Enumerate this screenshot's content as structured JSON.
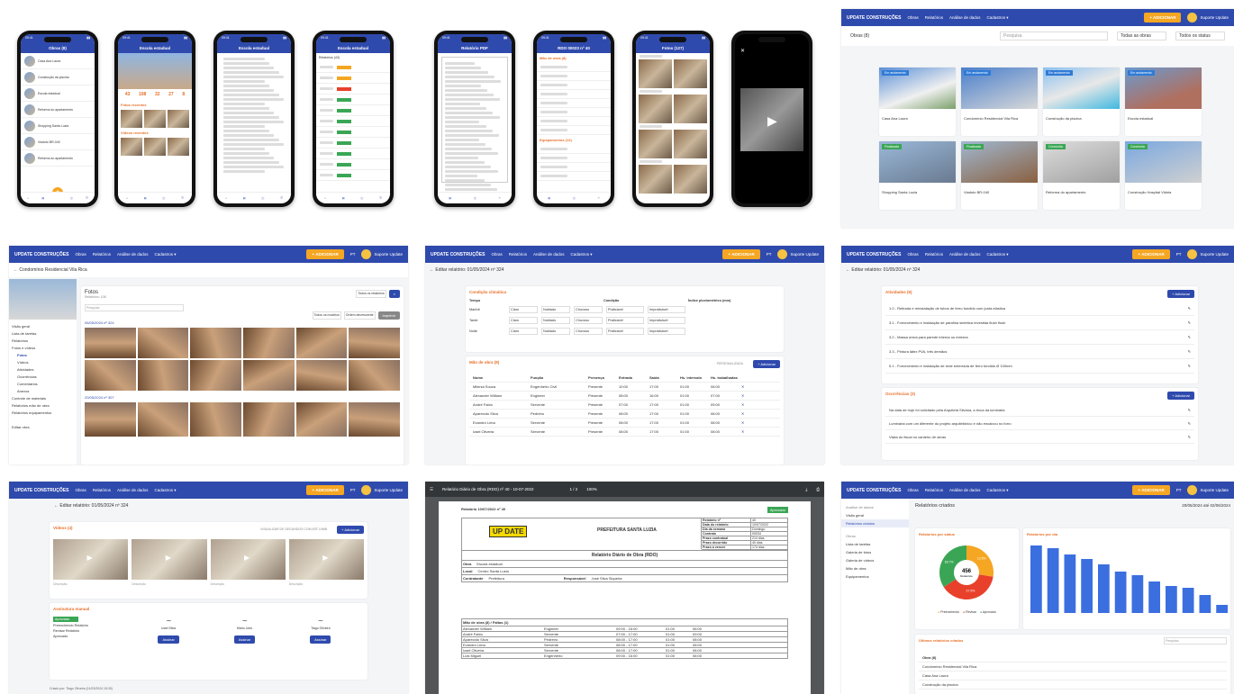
{
  "phones": [
    {
      "title": "Obras (8)",
      "items": [
        "Casa Ana Laura",
        "Construção da piscina",
        "Escola estadual",
        "Reforma do apartamento",
        "Shopping Santa Luzia",
        "Viaduto BR-040",
        "Reforma do apartamento"
      ]
    },
    {
      "title": "Escola estadual",
      "sec1": "Fotos recentes",
      "sec2": "Vídeos recentes",
      "stats": [
        "43",
        "108",
        "32",
        "27",
        "8"
      ]
    },
    {
      "title": "Escola estadual"
    },
    {
      "title": "Escola estadual",
      "sub": "Relatórios (43)"
    },
    {
      "title": "Relatório PDF"
    },
    {
      "title": "RDO 00023 nº 40",
      "sec1": "Mão de obra (8)",
      "sec2": "Equipamentos (12)"
    },
    {
      "title": "Fotos (127)"
    },
    {
      "title": ""
    }
  ],
  "top": {
    "brand": "UPDATE CONSTRUÇÕES",
    "menu": [
      "Obras",
      "Relatórios",
      "Análise de dados",
      "Cadastros ▾"
    ],
    "action": "+ ADICIONAR",
    "user": "Suporte Update",
    "lang": "PT"
  },
  "obras": {
    "title": "Obras (8)",
    "search": "Pesquisa",
    "filter1": "Todas as obras",
    "filter2": "Todos os status",
    "cards": [
      {
        "tag": "Em andamento",
        "name": "Casa Ana Laura"
      },
      {
        "tag": "Em andamento",
        "name": "Condomínio Residencial Vila Rica"
      },
      {
        "tag": "Em andamento",
        "name": "Construção da piscina"
      },
      {
        "tag": "Em andamento",
        "name": "Escola estadual"
      },
      {
        "tag": "Finalizada",
        "name": "Shopping Santa Luzia"
      },
      {
        "tag": "Finalizada",
        "name": "Viaduto BR-040"
      },
      {
        "tag": "Concluída",
        "name": "Reforma do apartamento"
      },
      {
        "tag": "Concluída",
        "name": "Construção Hospital Vitória"
      }
    ]
  },
  "fotos": {
    "back": "← Condomínio Residencial Vila Rica",
    "title": "Fotos",
    "sub": "Relatórios: 108",
    "side": [
      "Visão geral",
      "Lista de tarefas",
      "Relatórios",
      "Fotos e vídeos",
      "Fotos",
      "Vídeos",
      "Atividades",
      "Ocorrências",
      "Comentários",
      "Anexos",
      "Controle de materiais",
      "Relatórios mão de obra",
      "Relatórios equipamentos"
    ],
    "edit": "Editar obra",
    "d1": "05/05/2024 nº 324",
    "d2": "20/05/2024 nº 307",
    "search": "Pesquisa",
    "filter1": "Todos os relatórios",
    "filter2": "Todos os modelos",
    "order": "Ordem decrescente",
    "export": "Imprimir"
  },
  "edit1": {
    "title": "← Editar relatório: 01/05/2024 nº 324",
    "cond": "Condição climática",
    "tempo": "Tempo",
    "condicao": "Condição",
    "indice": "Índice pluviométrico (mm)",
    "periods": [
      "Manhã",
      "Tarde",
      "Noite"
    ],
    "claro": "Claro",
    "nublado": "Nublado",
    "chuvoso": "Chuvoso",
    "prat": "Praticável",
    "imprat": "Impraticável",
    "mao": "Mão de obra (8)",
    "cols": [
      "Nome",
      "Função",
      "Presença",
      "Entrada",
      "Saída",
      "Hs. intervalo",
      "Hs. trabalhadas"
    ],
    "rows": [
      [
        "Milenia Souza",
        "Engenheiro Civil",
        "Presente",
        "10:00",
        "17:00",
        "01:00",
        "06:00"
      ],
      [
        "Alexander William",
        "Engineer",
        "Presente",
        "08:00",
        "16:00",
        "01:00",
        "07:00"
      ],
      [
        "André Fabio",
        "Servente",
        "Presente",
        "07:00",
        "17:00",
        "01:00",
        "09:00"
      ],
      [
        "Aparecido Silva",
        "Pedreiro",
        "Presente",
        "08:00",
        "17:00",
        "01:00",
        "08:00"
      ],
      [
        "Evandro Lima",
        "Servente",
        "Presente",
        "08:00",
        "17:00",
        "01:00",
        "08:00"
      ],
      [
        "Izael Oliveira",
        "Servente",
        "Presente",
        "08:00",
        "17:00",
        "01:00",
        "08:00"
      ]
    ],
    "pers": "PERSONALIZADA",
    "add": "+ Adicionar"
  },
  "edit2": {
    "title": "← Editar relatório: 01/05/2024 nº 324",
    "ativ": "Atividades (5)",
    "ocor": "Ocorrências (3)",
    "add": "+ Adicionar",
    "acts": [
      "1.0 - Retirada e reinstalação de tubos de ferro fundido com junta elástica",
      "3.1 - Fornecimento e instalação de parafina sintética revestida flush flush",
      "3.2 - Massa única para parede interna ou externa",
      "3.3 - Pintura látex PVA, três demãos",
      "5.1 - Fornecimento e instalação de rede enterrada de ferro fundido Ø 100mm"
    ],
    "occs": [
      "Na data de hoje foi solicitado pela Arquiteta Silvana, a troca da luminária",
      "Luminária com um diferente do projeto arquitetônico e não encaixou no forro",
      "Visita do fiscal no canteiro de obras"
    ]
  },
  "edit3": {
    "title": "← Editar relatório: 01/05/2024 nº 324",
    "videos": "Vídeos (4)",
    "limit": "VISUALIZAR DE SEGUNDOS COM ATÉ 10MB",
    "add": "+ Adicionar",
    "desc": "Descrição",
    "assin": "Assinatura manual",
    "status": [
      "Aprovado",
      "Preenchendo Relatório",
      "Revisar Relatório",
      "Aprovado"
    ],
    "signers": [
      "Izael Silva",
      "Mário Jobs",
      "Tiago Oliveira"
    ],
    "btn": "Assinar",
    "footer": "Criado por: Tiago Oliveira (11/03/2024 15:30)"
  },
  "pdf": {
    "bar": "Relatório Diário de Obra (RDO) nº 40 - 10-07-2022",
    "page": "1 / 2",
    "zoom": "100%",
    "tag": "Aprovado",
    "head": "Relatório 10/07/2022 nº 40",
    "logo": "UP DATE",
    "pref": "PREFEITURA SANTA LUZIA",
    "rdo": "Relatório Diário de Obra (RDO)",
    "info": [
      [
        "Relatório nº",
        "40"
      ],
      [
        "Data do relatório",
        "10/07/2022"
      ],
      [
        "Dia da semana",
        "Domingo"
      ],
      [
        "Contrato",
        "00034"
      ],
      [
        "Prazo contratual",
        "214 dias"
      ],
      [
        "Prazo decorrido",
        "40 dias"
      ],
      [
        "Prazo a vencer",
        "174 dias"
      ]
    ],
    "obra": "Escola estadual",
    "local": "Centro Santa Luzia",
    "contr": "Prefeitura",
    "resp": "José Silva Siqueira",
    "mao": "Mão de obra (8) / Faltas (1)",
    "workers": [
      [
        "Alexander William",
        "Engineer",
        "09:00 - 16:00",
        "01:00",
        "06:00"
      ],
      [
        "André Fabio",
        "Servente",
        "07:00 - 17:00",
        "01:00",
        "09:00"
      ],
      [
        "Aparecido Silva",
        "Pedreiro",
        "08:00 - 17:00",
        "01:00",
        "08:00"
      ],
      [
        "Evandro Lima",
        "Servente",
        "08:00 - 17:00",
        "01:00",
        "08:00"
      ],
      [
        "Izael Oliveira",
        "Servente",
        "08:00 - 17:00",
        "01:00",
        "08:00"
      ],
      [
        "Luis Miguel",
        "Engenheiro",
        "09:00 - 16:00",
        "01:00",
        "06:00"
      ]
    ]
  },
  "dash": {
    "title": "Relatórios criados",
    "range": "20/05/2024 até 02/06/2024",
    "side": [
      "Análise de dados",
      "Visão geral",
      "Relatórios criados",
      "Obras",
      "Lista de tarefas",
      "Galeria de fotos",
      "Galeria de vídeos",
      "Mão de obra",
      "Equipamentos"
    ],
    "pie": {
      "title": "Relatórios por status",
      "total": "456",
      "sub": "Relatórios",
      "legend": [
        "Preenchendo",
        "Revisar",
        "Aprovado"
      ],
      "colors": [
        "#f5a623",
        "#e8402a",
        "#3aa655"
      ],
      "values": [
        27.5,
        38.5,
        34.0
      ],
      "labels": [
        "12.5%",
        "27.5%",
        "60.7%"
      ]
    },
    "bar": {
      "title": "Relatórios por dia",
      "values": [
        75,
        72,
        65,
        60,
        54,
        46,
        42,
        35,
        30,
        28,
        20,
        9
      ],
      "ymax": 80
    },
    "tableTitle": "Últimos relatórios criados",
    "search": "Pesquisa",
    "col": "Obra (8)",
    "obras": [
      "Condomínio Residencial Vila Rica",
      "Casa Ana Laura",
      "Construção da piscina"
    ]
  }
}
